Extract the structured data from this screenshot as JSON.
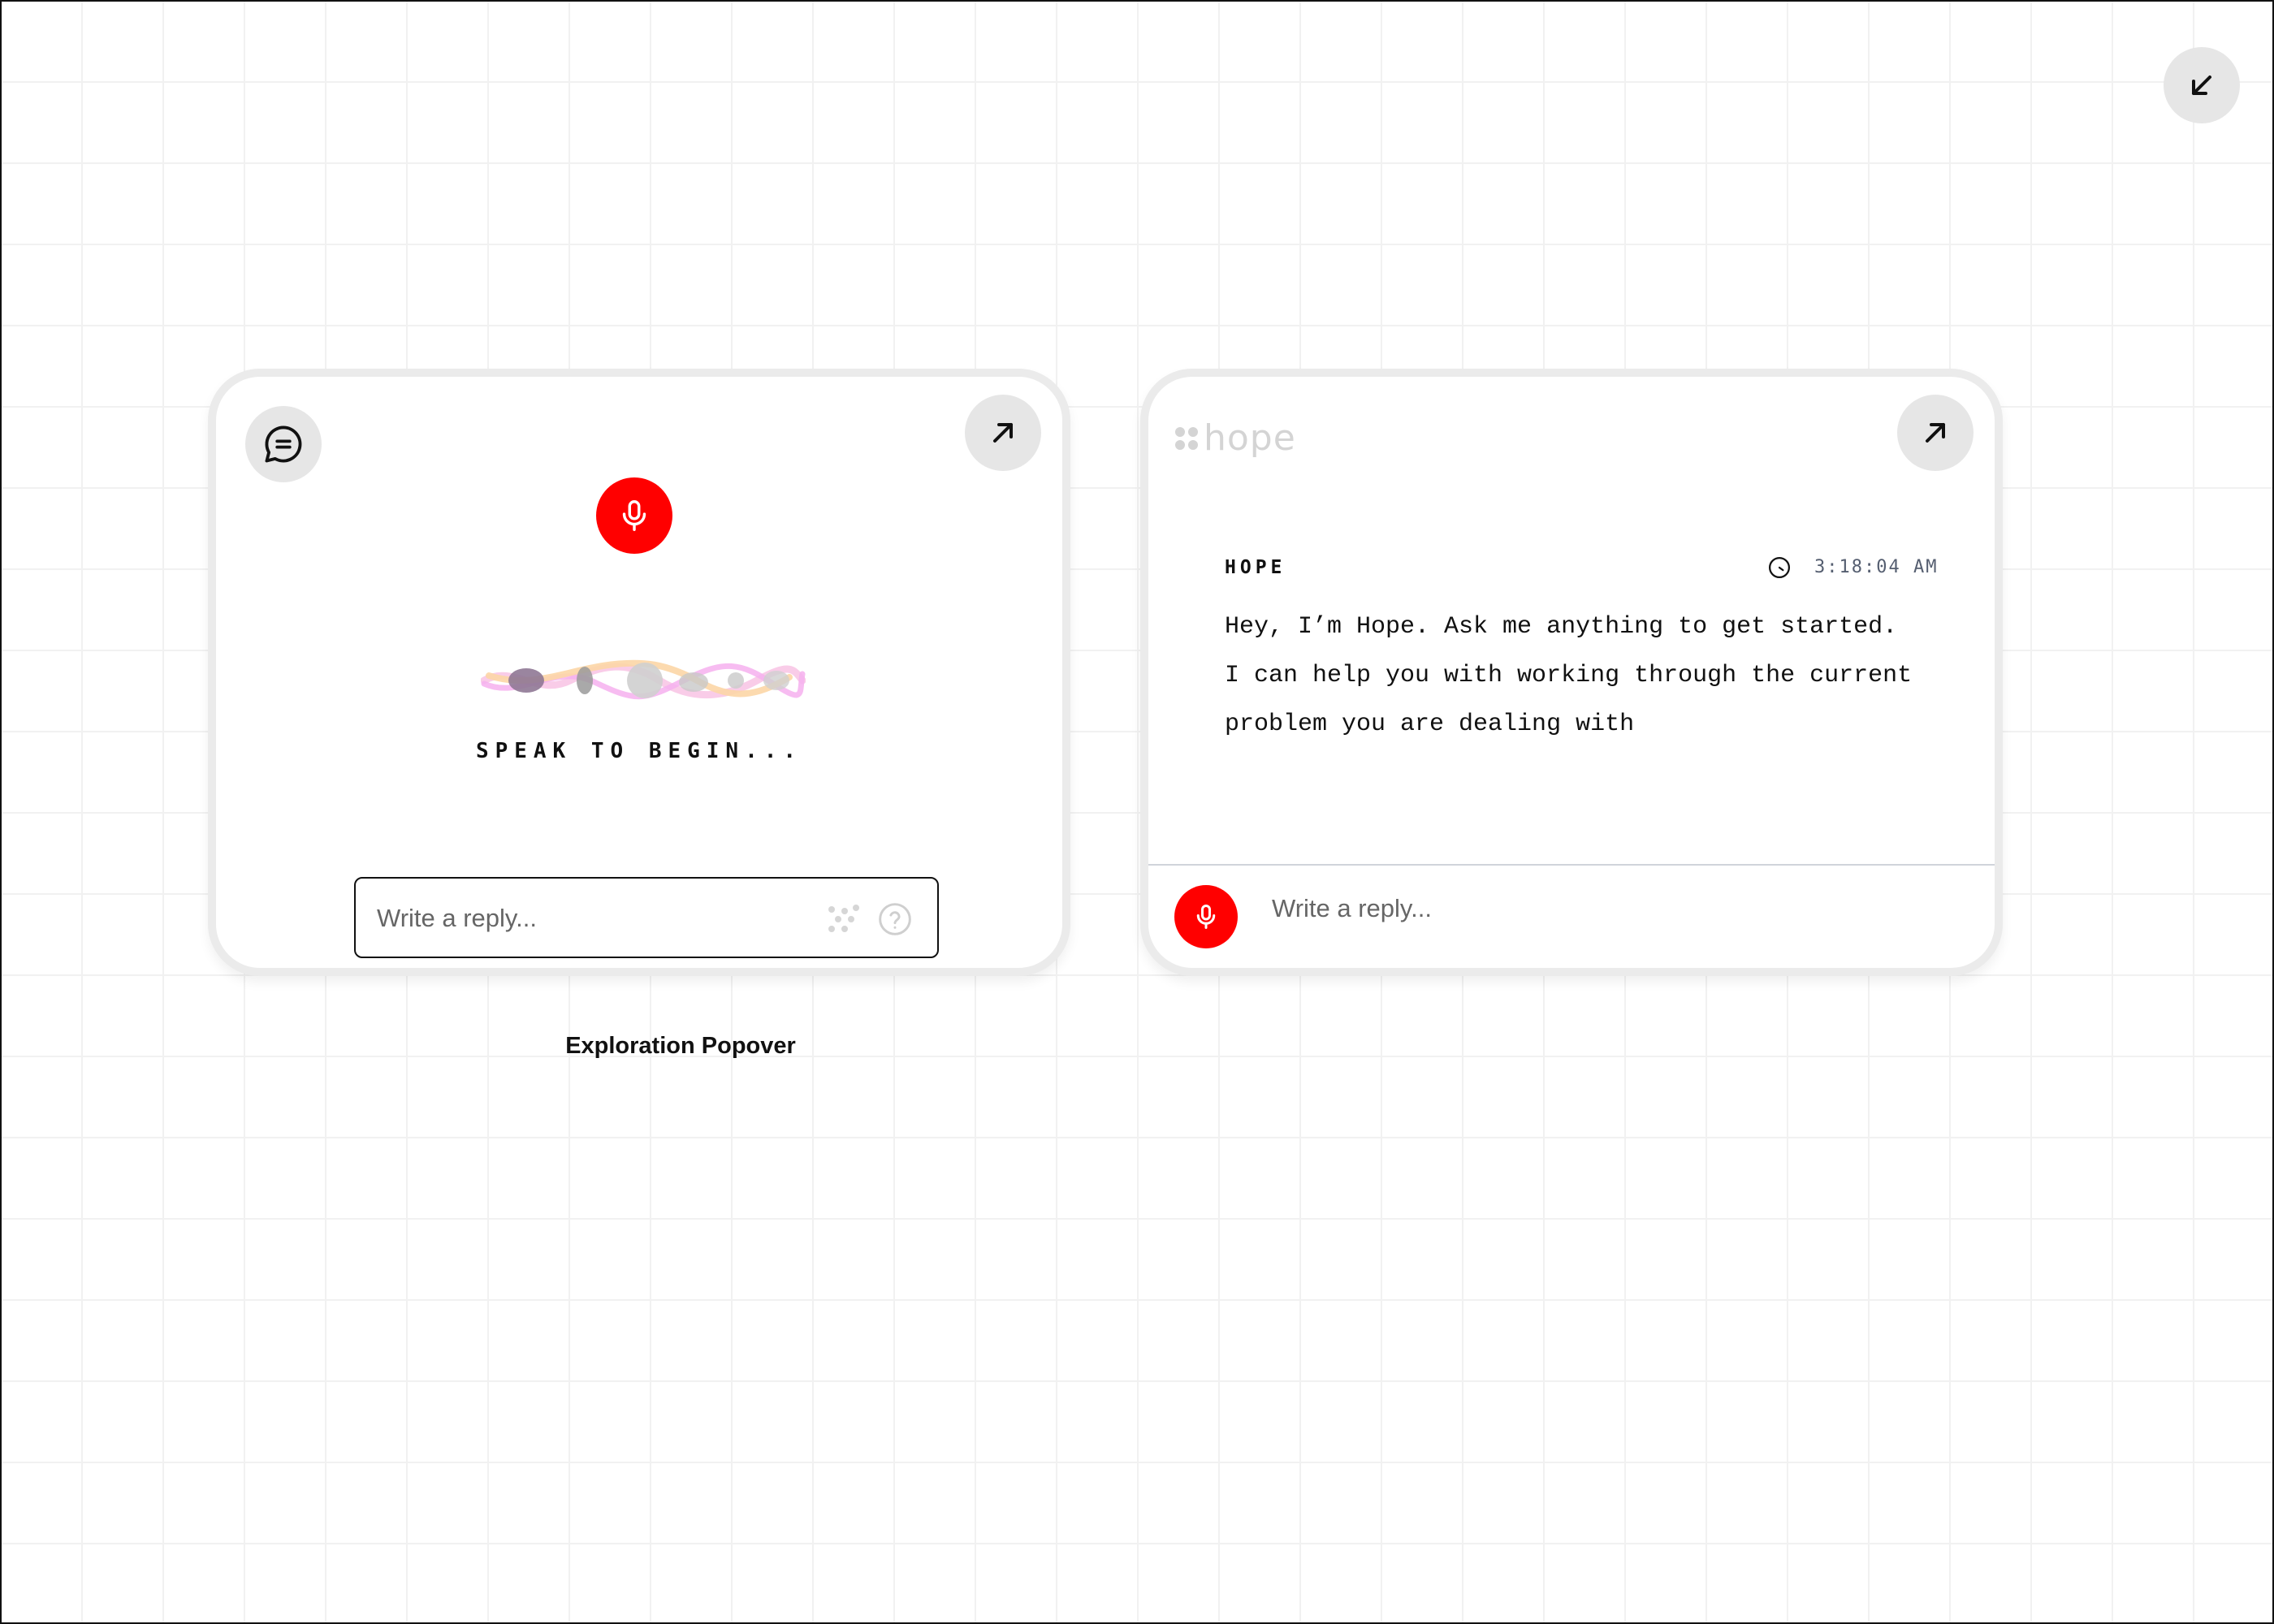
{
  "canvas": {
    "collapse_button": {
      "icon": "arrow-down-left-icon"
    }
  },
  "popover_left": {
    "chat_button": {
      "icon": "chat-bubble-icon"
    },
    "expand_button": {
      "icon": "arrow-up-right-icon"
    },
    "mic_button": {
      "icon": "microphone-icon",
      "color": "#ff0000"
    },
    "waveform": {
      "icon": "voice-waveform-icon",
      "colors": [
        "#f7b5f0",
        "#fcd9a8",
        "#8f7b9a",
        "#bdbdbd"
      ]
    },
    "status_label": "SPEAK TO BEGIN...",
    "reply": {
      "placeholder": "Write a reply...",
      "value": ""
    },
    "dots_icon": "dots-grid-icon",
    "help_icon": "help-circle-icon"
  },
  "caption": "Exploration Popover",
  "popover_right": {
    "logo_text": "hope",
    "expand_button": {
      "icon": "arrow-up-right-icon"
    },
    "message": {
      "author": "HOPE",
      "time": "3:18:04 AM",
      "lines": [
        "Hey, I’m Hope. Ask me anything to get started.",
        "I can help you with working through the current",
        "problem you are dealing with"
      ]
    },
    "mic_button": {
      "icon": "microphone-icon",
      "color": "#ff0000"
    },
    "reply": {
      "placeholder": "Write a reply...",
      "value": ""
    }
  }
}
